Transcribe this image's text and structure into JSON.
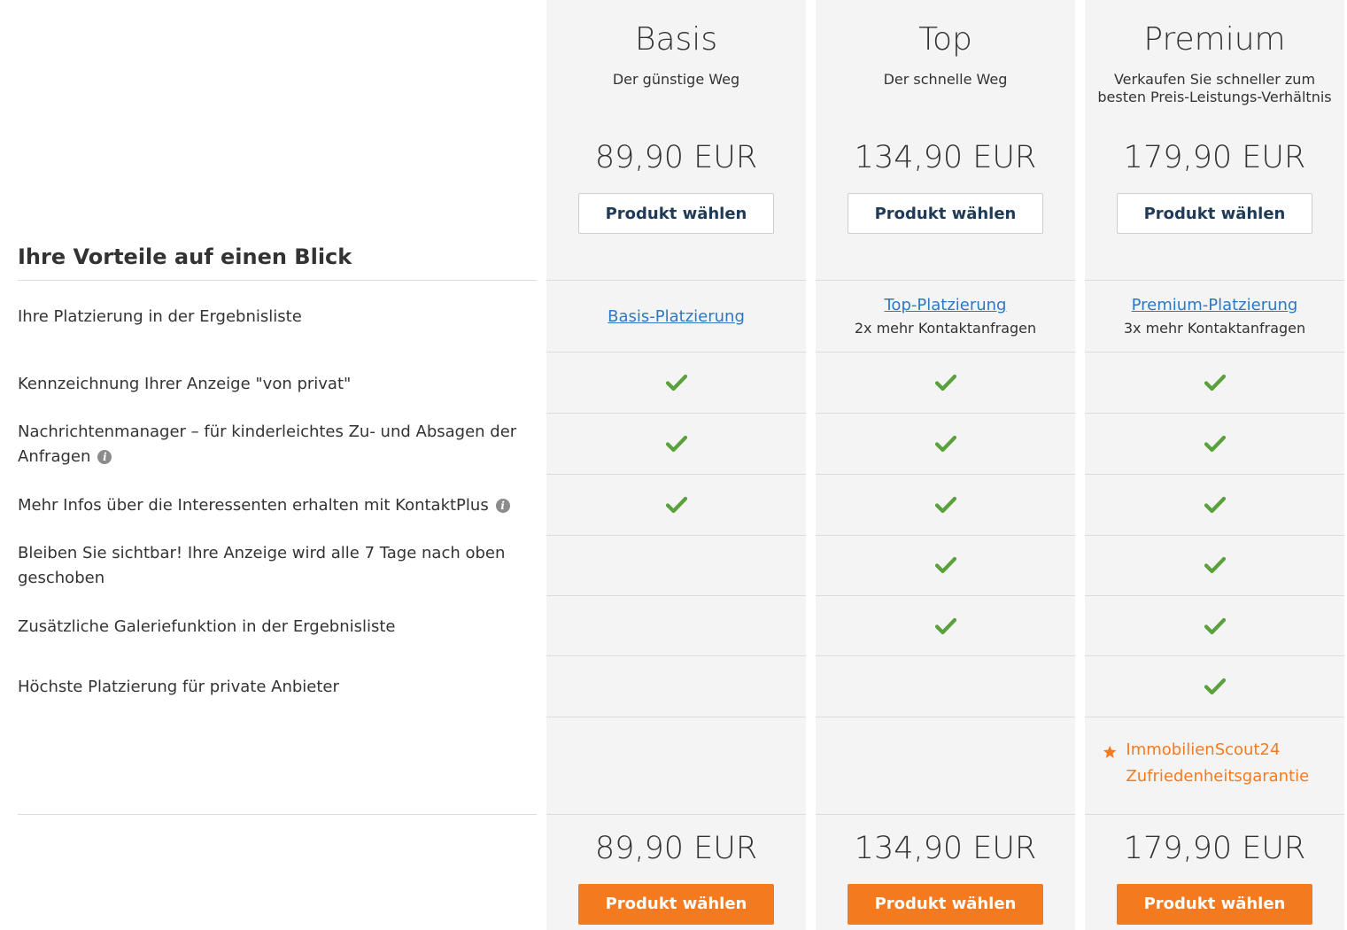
{
  "section_title": "Ihre Vorteile auf einen Blick",
  "features": [
    {
      "label": "Ihre Platzierung in der Ergebnisliste",
      "info": false
    },
    {
      "label": "Kennzeichnung Ihrer Anzeige \"von privat\"",
      "info": false
    },
    {
      "label": "Nachrichtenmanager – für kinderleichtes Zu- und Absagen der Anfragen",
      "info": true
    },
    {
      "label": "Mehr Infos über die Interessenten erhalten mit KontaktPlus",
      "info": true
    },
    {
      "label": "Bleiben Sie sichtbar! Ihre Anzeige wird alle 7 Tage nach oben geschoben",
      "info": false
    },
    {
      "label": "Zusätzliche Galeriefunktion in der Ergebnisliste",
      "info": false
    },
    {
      "label": "Höchste Platzierung für private Anbieter",
      "info": false
    }
  ],
  "plans": [
    {
      "name": "Basis",
      "subtitle": "Der günstige Weg",
      "price": "89,90 EUR",
      "button_label": "Produkt wählen",
      "placement_link": "Basis-Platzierung",
      "placement_note": "",
      "checks": [
        true,
        true,
        true,
        false,
        false,
        false
      ]
    },
    {
      "name": "Top",
      "subtitle": "Der schnelle Weg",
      "price": "134,90 EUR",
      "button_label": "Produkt wählen",
      "placement_link": "Top-Platzierung",
      "placement_note": "2x mehr Kontaktanfragen",
      "checks": [
        true,
        true,
        true,
        true,
        true,
        false
      ]
    },
    {
      "name": "Premium",
      "subtitle": "Verkaufen Sie schneller zum besten Preis-Leistungs-Verhältnis",
      "price": "179,90 EUR",
      "button_label": "Produkt wählen",
      "placement_link": "Premium-Platzierung",
      "placement_note": "3x mehr Kontaktanfragen",
      "checks": [
        true,
        true,
        true,
        true,
        true,
        true
      ],
      "guarantee": "ImmobilienScout24 Zufriedenheitsgarantie"
    }
  ],
  "colors": {
    "accent_orange": "#f47a20",
    "link_blue": "#2e78c1",
    "check_green": "#5aa13c",
    "column_bg": "#f4f4f4",
    "outline_btn_text": "#1d3a57"
  },
  "icons": {
    "check": "check-icon",
    "info": "info-icon",
    "star": "star-icon"
  }
}
